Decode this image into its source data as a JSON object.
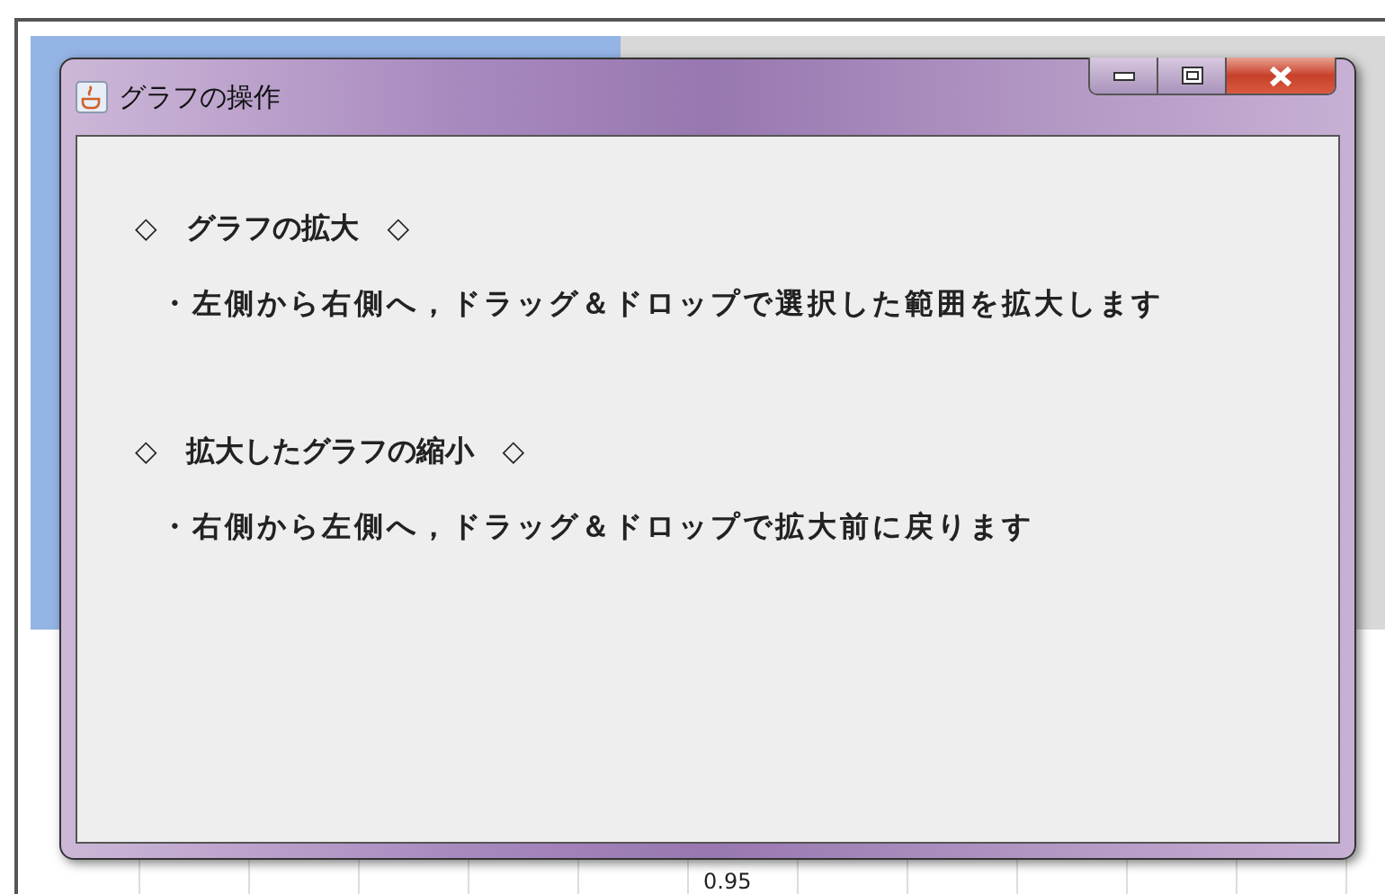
{
  "window": {
    "title": "グラフの操作"
  },
  "sections": [
    {
      "heading": "◇　グラフの拡大　◇",
      "items": [
        "・左側から右側へ，ドラッグ＆ドロップで選択した範囲を拡大します"
      ]
    },
    {
      "heading": "◇　拡大したグラフの縮小　◇",
      "items": [
        "・右側から左側へ，ドラッグ＆ドロップで拡大前に戻ります"
      ]
    }
  ],
  "background_chart": {
    "tick_label": "0.95"
  }
}
